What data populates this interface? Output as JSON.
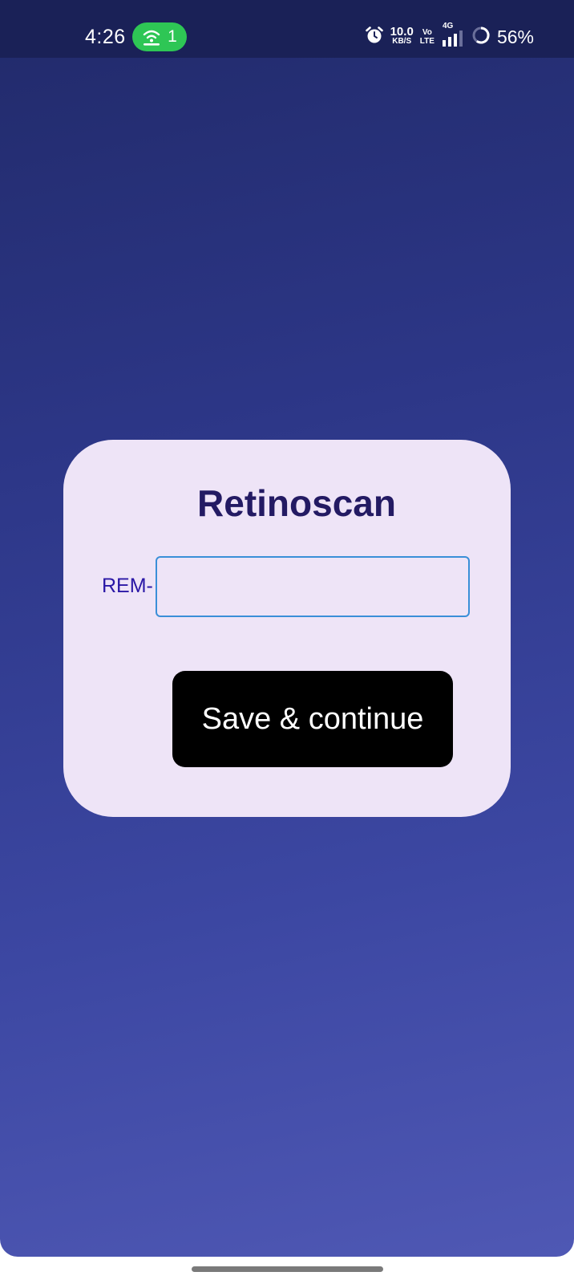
{
  "status_bar": {
    "time": "4:26",
    "hotspot_count": "1",
    "net_speed_value": "10.0",
    "net_speed_unit": "KB/S",
    "volte_top": "Vo",
    "volte_bottom": "LTE",
    "network_type": "4G",
    "battery_percent": "56%"
  },
  "card": {
    "title": "Retinoscan",
    "id_prefix": "REM-",
    "id_input_value": "",
    "id_input_placeholder": "",
    "save_label": "Save & continue"
  },
  "colors": {
    "card_background": "#eee4f7",
    "title_color": "#231a63",
    "prefix_color": "#2a17a6",
    "input_border": "#3a8fd8",
    "button_background": "#000000",
    "hotspot_pill": "#2ec655"
  }
}
